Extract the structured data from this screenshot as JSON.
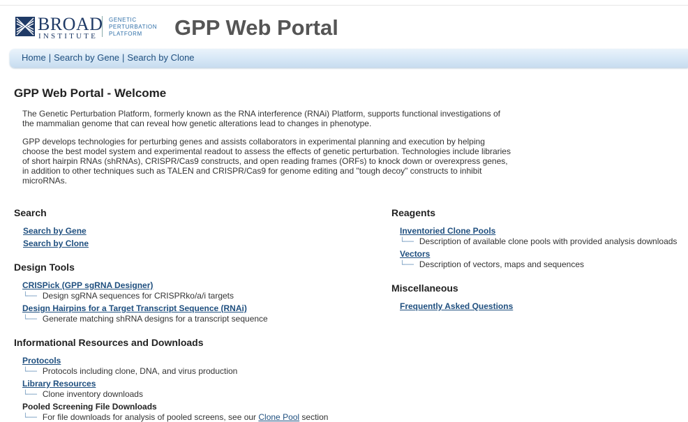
{
  "header": {
    "logo_text_1": "BROAD",
    "logo_text_2": "INSTITUTE",
    "logo_gpp": [
      "GENETIC",
      "PERTURBATION",
      "PLATFORM"
    ],
    "title": "GPP Web Portal"
  },
  "nav": {
    "home": "Home",
    "sep": "|",
    "search_gene": "Search by Gene",
    "search_clone": "Search by Clone"
  },
  "page_title": "GPP Web Portal - Welcome",
  "intro": {
    "p1": "The Genetic Perturbation Platform, formerly known as the RNA interference (RNAi) Platform, supports functional investigations of the mammalian genome that can reveal how genetic alterations lead to changes in phenotype.",
    "p2": "GPP develops technologies for perturbing genes and assists collaborators in experimental planning and execution by helping choose the best model system and experimental readout to assess the effects of genetic perturbation. Technologies include libraries of short hairpin RNAs (shRNAs), CRISPR/Cas9 constructs, and open reading frames (ORFs) to knock down or overexpress genes, in addition to other techniques such as TALEN and CRISPR/Cas9 for genome editing and \"tough decoy\" constructs to inhibit microRNAs."
  },
  "arrow": "└──",
  "left": {
    "search": {
      "heading": "Search",
      "links": [
        "Search by Gene",
        "Search by Clone"
      ]
    },
    "design": {
      "heading": "Design Tools",
      "items": [
        {
          "label": "CRISPick (GPP sgRNA Designer)",
          "desc": "Design sgRNA sequences for CRISPRko/a/i targets"
        },
        {
          "label": "Design Hairpins for a Target Transcript Sequence (RNAi)",
          "desc": "Generate matching shRNA designs for a transcript sequence"
        }
      ]
    },
    "info": {
      "heading": "Informational Resources and Downloads",
      "items": [
        {
          "label": "Protocols",
          "desc": "Protocols including clone, DNA, and virus production"
        },
        {
          "label": "Library Resources",
          "desc": "Clone inventory downloads"
        }
      ],
      "pooled_heading": "Pooled Screening File Downloads",
      "pooled_desc_pre": "For file downloads for analysis of pooled screens, see our ",
      "pooled_desc_link": "Clone Pool",
      "pooled_desc_post": " section"
    }
  },
  "right": {
    "reagents": {
      "heading": "Reagents",
      "items": [
        {
          "label": "Inventoried Clone Pools",
          "desc": "Description of available clone pools with provided analysis downloads"
        },
        {
          "label": "Vectors",
          "desc": "Description of vectors, maps and sequences"
        }
      ]
    },
    "misc": {
      "heading": "Miscellaneous",
      "links": [
        "Frequently Asked Questions"
      ]
    }
  },
  "colors": {
    "link": "#1f4f7f",
    "nav_bg": "#d6e7f6",
    "title_gray": "#555555",
    "logo_blue": "#1f3a66"
  }
}
